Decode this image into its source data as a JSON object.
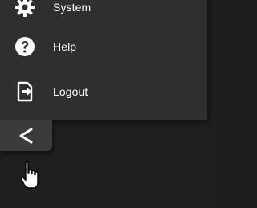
{
  "menu": {
    "items": [
      {
        "id": "system",
        "label": "System",
        "icon": "gear-icon"
      },
      {
        "id": "help",
        "label": "Help",
        "icon": "help-circle-icon"
      },
      {
        "id": "logout",
        "label": "Logout",
        "icon": "logout-icon"
      }
    ]
  },
  "collapse_button": {
    "icon": "chevron-left-icon"
  },
  "pointer": {
    "icon": "hand-pointer-cursor-icon"
  },
  "colors": {
    "background": "#1f1f1f",
    "panel": "#2f2f2f",
    "tab": "#3b3b3b",
    "text": "#ffffff"
  }
}
